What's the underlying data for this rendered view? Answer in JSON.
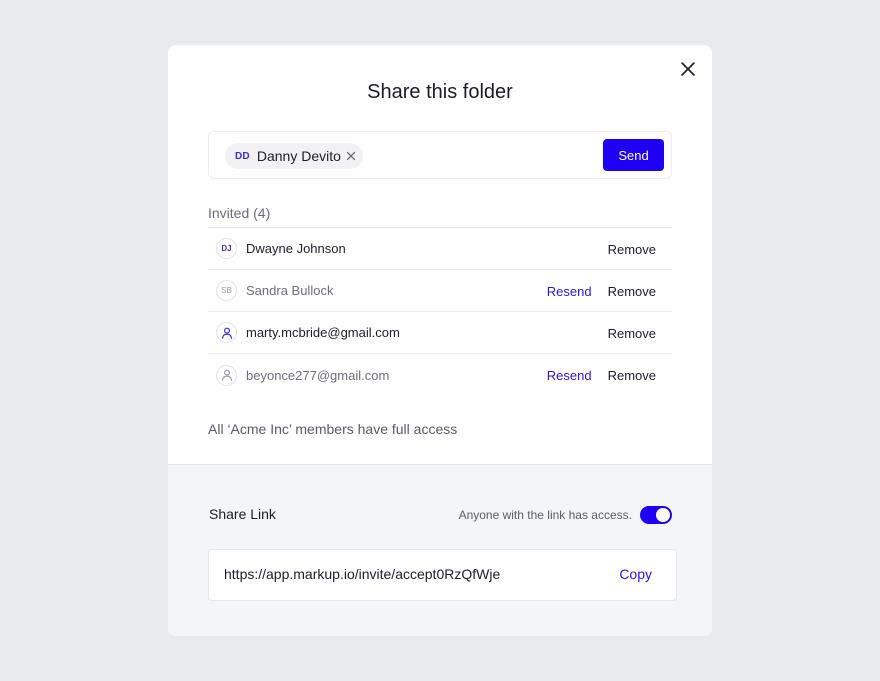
{
  "modal": {
    "title": "Share this folder",
    "close_icon": "close-icon"
  },
  "invite": {
    "chip": {
      "initials": "DD",
      "name": "Danny Devito"
    },
    "send_label": "Send"
  },
  "invited": {
    "label": "Invited (4)",
    "rows": [
      {
        "avatar": "DJ",
        "name": "Dwayne Johnson",
        "status": "accepted",
        "remove_label": "Remove"
      },
      {
        "avatar": "SB",
        "name": "Sandra Bullock",
        "status": "pending",
        "resend_label": "Resend",
        "remove_label": "Remove"
      },
      {
        "avatar": "user-icon",
        "name": "marty.mcbride@gmail.com",
        "status": "accepted",
        "remove_label": "Remove"
      },
      {
        "avatar": "user-icon",
        "name": "beyonce277@gmail.com",
        "status": "pending",
        "resend_label": "Resend",
        "remove_label": "Remove"
      }
    ]
  },
  "access_note": "All ‘Acme Inc’ members have full access",
  "share_link": {
    "label": "Share Link",
    "toggle_text": "Anyone with the link has access.",
    "toggle_on": true,
    "url": "https://app.markup.io/invite/accept0RzQfWje",
    "copy_label": "Copy"
  },
  "colors": {
    "accent": "#1e00f2",
    "link": "#2d15e6",
    "background": "#e9eaec",
    "footer": "#f4f5f7"
  }
}
